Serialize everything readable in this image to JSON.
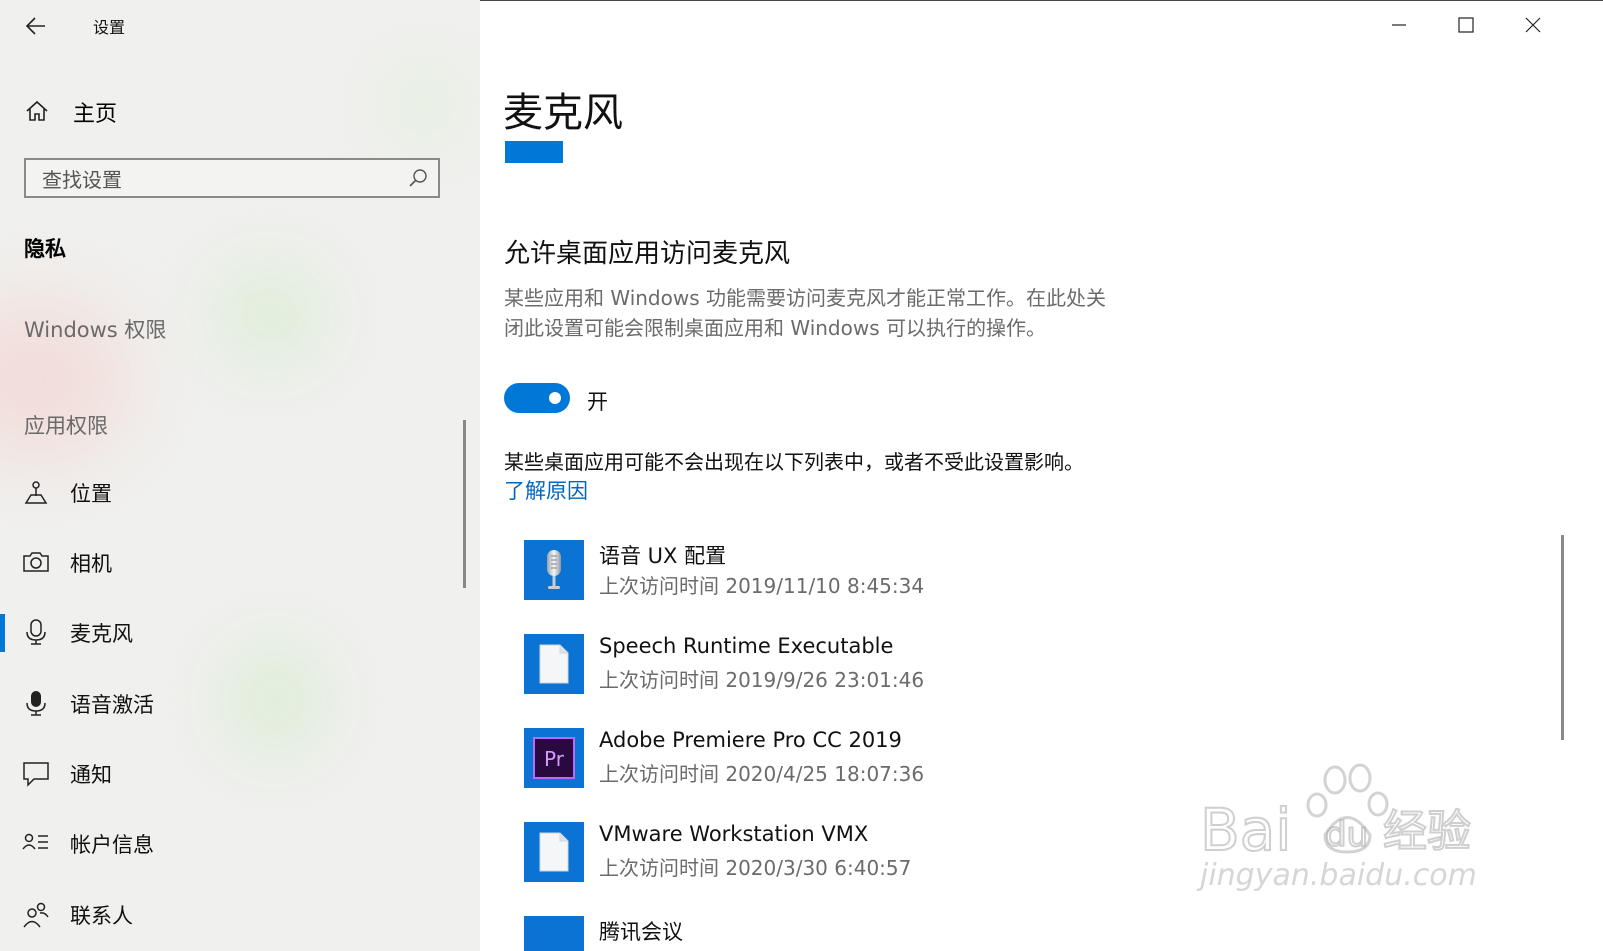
{
  "window": {
    "title": "设置",
    "controls": [
      "minimize",
      "maximize",
      "close"
    ]
  },
  "sidebar": {
    "home_label": "主页",
    "search_placeholder": "查找设置",
    "section_title": "隐私",
    "windows_permissions_header": "Windows 权限",
    "app_permissions_header": "应用权限",
    "items": [
      {
        "label": "位置",
        "icon": "location-icon",
        "selected": false
      },
      {
        "label": "相机",
        "icon": "camera-icon",
        "selected": false
      },
      {
        "label": "麦克风",
        "icon": "microphone-icon",
        "selected": true
      },
      {
        "label": "语音激活",
        "icon": "voice-activation-icon",
        "selected": false
      },
      {
        "label": "通知",
        "icon": "notification-icon",
        "selected": false
      },
      {
        "label": "帐户信息",
        "icon": "account-info-icon",
        "selected": false
      },
      {
        "label": "联系人",
        "icon": "contacts-icon",
        "selected": false
      }
    ]
  },
  "main": {
    "page_title": "麦克风",
    "section_heading": "允许桌面应用访问麦克风",
    "description_line1": "某些应用和 Windows 功能需要访问麦克风才能正常工作。在此处关",
    "description_line2": "闭此设置可能会限制桌面应用和 Windows 可以执行的操作。",
    "toggle_state": "开",
    "toggle_on": true,
    "note": "某些桌面应用可能不会出现在以下列表中，或者不受此设置影响。",
    "learn_more_link": "了解原因",
    "apps": [
      {
        "name": "语音 UX 配置",
        "last_access": "上次访问时间 2019/11/10 8:45:34",
        "icon": "microphone-app-icon"
      },
      {
        "name": "Speech Runtime Executable",
        "last_access": "上次访问时间 2019/9/26 23:01:46",
        "icon": "file-icon"
      },
      {
        "name": "Adobe Premiere Pro CC 2019",
        "last_access": "上次访问时间 2020/4/25 18:07:36",
        "icon": "premiere-pro-icon",
        "icon_text": "Pr"
      },
      {
        "name": "VMware Workstation VMX",
        "last_access": "上次访问时间 2020/3/30 6:40:57",
        "icon": "file-icon"
      },
      {
        "name": "腾讯会议",
        "last_access": "",
        "icon": "app-icon"
      }
    ]
  },
  "watermark": {
    "text_main": "Bai",
    "text_main2": "du",
    "text_cn": "经验",
    "text_url": "jingyan.baidu.com"
  },
  "colors": {
    "accent": "#0078d7",
    "link": "#0067c0",
    "app_tile": "#0a73d4",
    "premiere_bg": "#2a0a3e",
    "premiere_fg": "#d59bff"
  }
}
